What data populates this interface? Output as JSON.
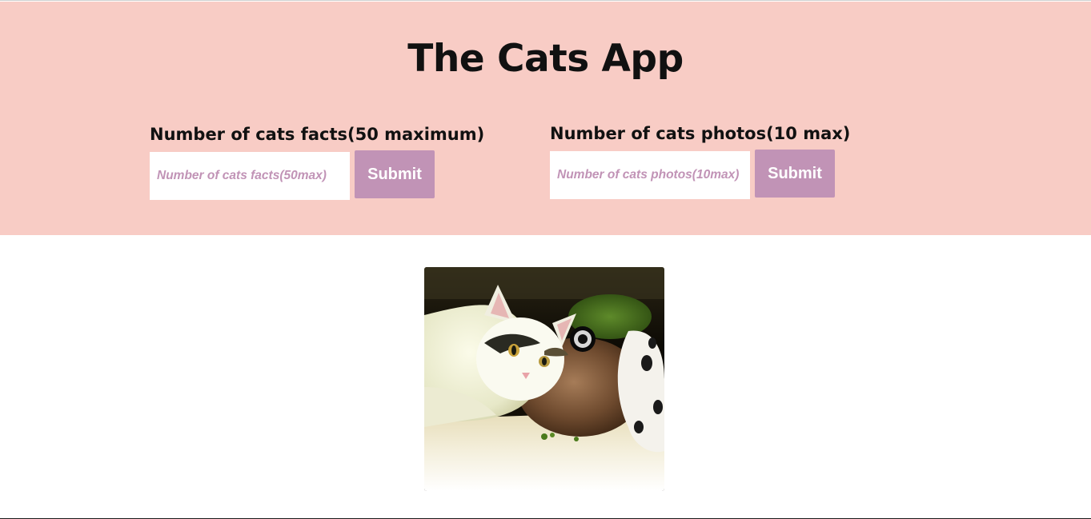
{
  "header": {
    "title": "The Cats App",
    "background_color": "#f8ccc5"
  },
  "facts_form": {
    "label": "Number of cats facts(50 maximum)",
    "input_placeholder": "Number of cats facts(50max)",
    "input_value": "",
    "submit_label": "Submit"
  },
  "photos_form": {
    "label": "Number of cats photos(10 max)",
    "input_placeholder": "Number of cats photos(10max)",
    "input_value": "",
    "submit_label": "Submit"
  },
  "colors": {
    "accent": "#c193b6",
    "title_text": "#111111"
  },
  "photos": [
    {
      "icon": "cat-photo",
      "description": "cat with toy"
    }
  ]
}
